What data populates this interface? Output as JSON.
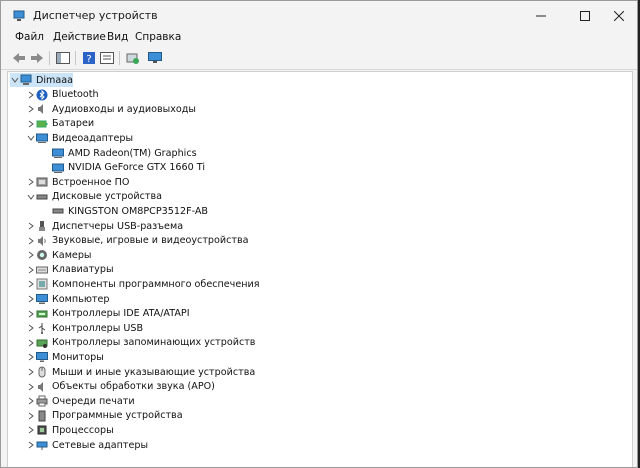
{
  "window": {
    "title": "Диспетчер устройств"
  },
  "menu": [
    {
      "label": "Файл"
    },
    {
      "label": "Действие"
    },
    {
      "label": "Вид"
    },
    {
      "label": "Справка"
    }
  ],
  "tree": {
    "root": {
      "label": "Dimaaa"
    },
    "items": [
      {
        "label": "Bluetooth",
        "icon": "bluetooth-icon",
        "expanded": false
      },
      {
        "label": "Аудиовходы и аудиовыходы",
        "icon": "speaker-icon",
        "expanded": false
      },
      {
        "label": "Батареи",
        "icon": "battery-icon",
        "expanded": false
      },
      {
        "label": "Видеоадаптеры",
        "icon": "display-adapter-icon",
        "expanded": true,
        "children": [
          {
            "label": "AMD Radeon(TM) Graphics"
          },
          {
            "label": "NVIDIA GeForce GTX 1660 Ti"
          }
        ]
      },
      {
        "label": "Встроенное ПО",
        "icon": "firmware-icon",
        "expanded": false
      },
      {
        "label": "Дисковые устройства",
        "icon": "disk-drive-icon",
        "expanded": true,
        "children": [
          {
            "label": "KINGSTON OM8PCP3512F-AB"
          }
        ]
      },
      {
        "label": "Диспетчеры USB-разъема",
        "icon": "usb-connector-icon",
        "expanded": false
      },
      {
        "label": "Звуковые, игровые и видеоустройства",
        "icon": "sound-device-icon",
        "expanded": false
      },
      {
        "label": "Камеры",
        "icon": "camera-icon",
        "expanded": false
      },
      {
        "label": "Клавиатуры",
        "icon": "keyboard-icon",
        "expanded": false
      },
      {
        "label": "Компоненты программного обеспечения",
        "icon": "software-component-icon",
        "expanded": false
      },
      {
        "label": "Компьютер",
        "icon": "computer-icon",
        "expanded": false
      },
      {
        "label": "Контроллеры IDE ATA/ATAPI",
        "icon": "ide-controller-icon",
        "expanded": false
      },
      {
        "label": "Контроллеры USB",
        "icon": "usb-controller-icon",
        "expanded": false
      },
      {
        "label": "Контроллеры запоминающих устройств",
        "icon": "storage-controller-icon",
        "expanded": false
      },
      {
        "label": "Мониторы",
        "icon": "monitor-icon",
        "expanded": false
      },
      {
        "label": "Мыши и иные указывающие устройства",
        "icon": "mouse-icon",
        "expanded": false
      },
      {
        "label": "Объекты обработки звука (APO)",
        "icon": "audio-processing-icon",
        "expanded": false
      },
      {
        "label": "Очереди печати",
        "icon": "printer-icon",
        "expanded": false
      },
      {
        "label": "Программные устройства",
        "icon": "software-device-icon",
        "expanded": false
      },
      {
        "label": "Процессоры",
        "icon": "processor-icon",
        "expanded": false
      },
      {
        "label": "Сетевые адаптеры",
        "icon": "network-adapter-icon",
        "expanded": false
      }
    ]
  },
  "colors": {
    "selection": "#cce4f7",
    "monitor_blue": "#3c8fd6",
    "window_bg": "#f3f3f3"
  }
}
